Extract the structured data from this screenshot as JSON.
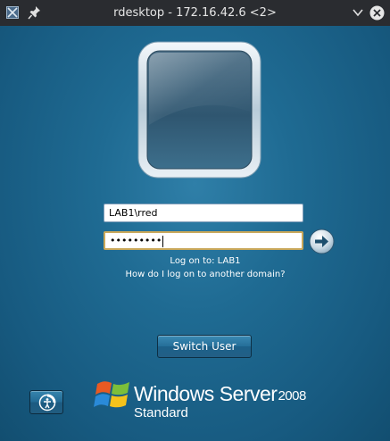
{
  "window": {
    "title": "rdesktop - 172.16.42.6 <2>",
    "icons": [
      "rdesktop-app-icon",
      "pin-icon",
      "minimize-chevron-icon",
      "close-x-icon"
    ]
  },
  "login": {
    "username_value": "LAB1\\rred",
    "password_mask": "•••••••••",
    "submit_icon": "arrow-right-icon",
    "log_on_to": "Log on to: LAB1",
    "domain_help_link": "How do I log on to another domain?"
  },
  "actions": {
    "switch_user_label": "Switch User",
    "ease_of_access_icon": "ease-of-access-icon"
  },
  "branding": {
    "product": "Windows Server",
    "version": "2008",
    "edition": "Standard",
    "logo_icon": "windows-flag-logo"
  },
  "colors": {
    "background": "#1b5f86",
    "titlebar": "#2a2c30",
    "focus_border": "#c9a85a"
  }
}
